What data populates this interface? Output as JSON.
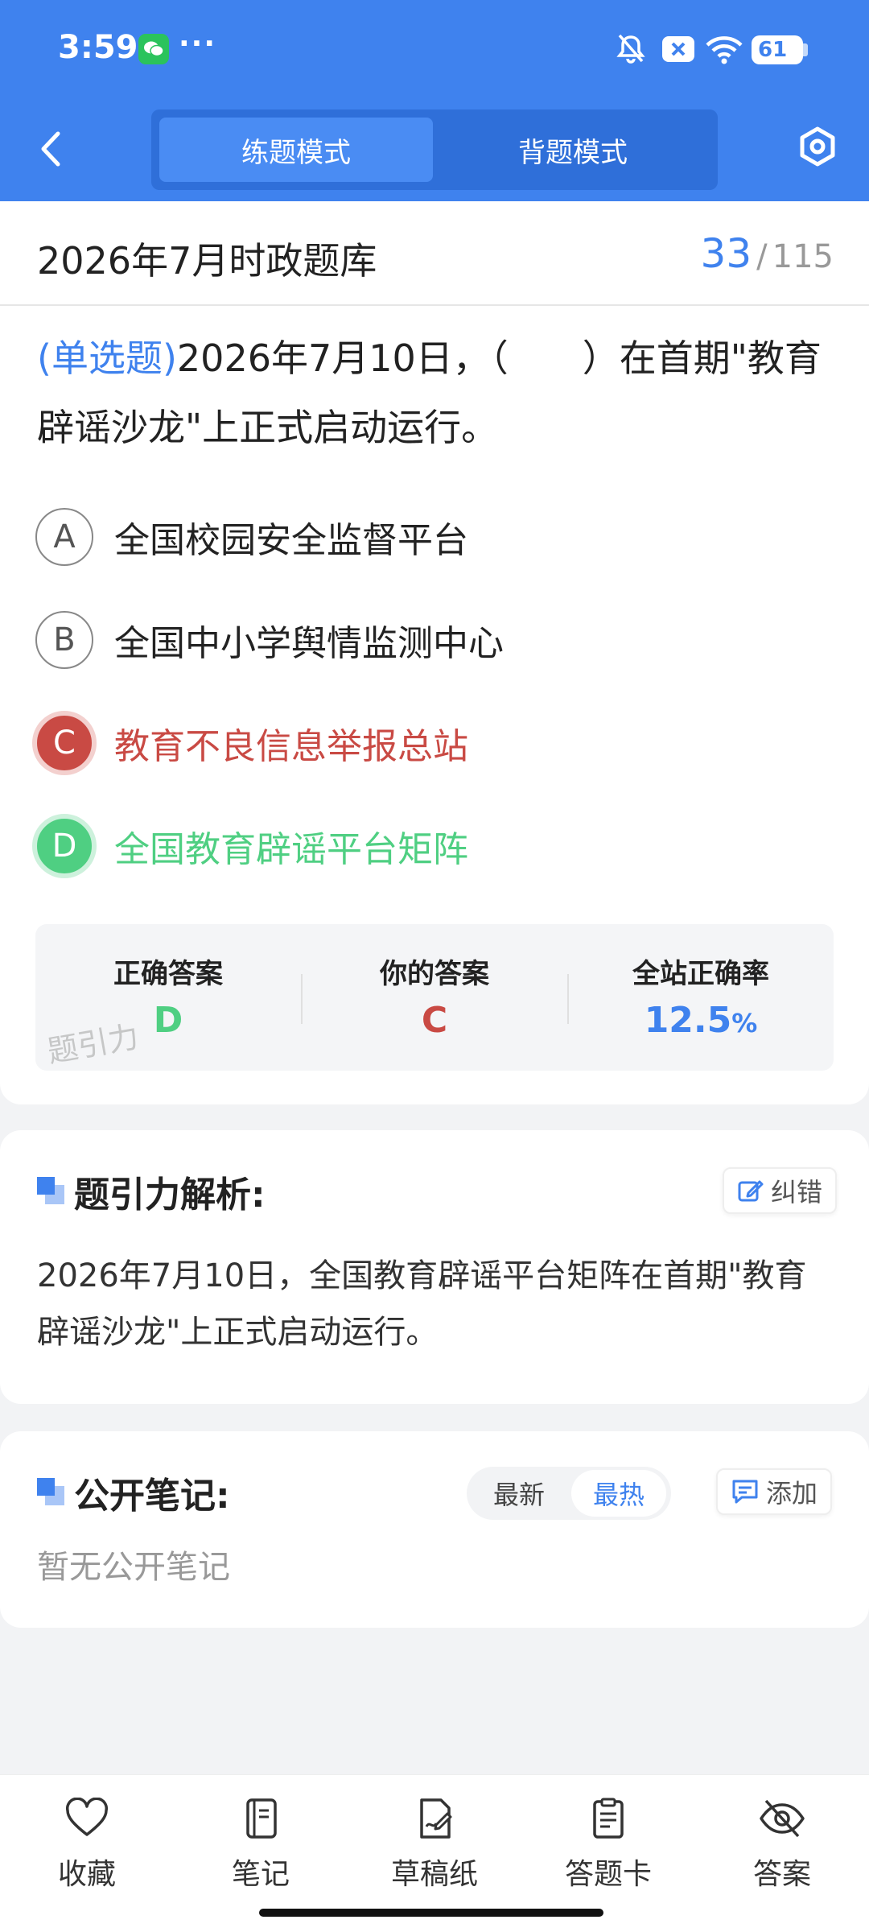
{
  "status_bar": {
    "time": "3:59",
    "more": "···",
    "battery": "61"
  },
  "header": {
    "mode_practice": "练题模式",
    "mode_recite": "背题模式"
  },
  "question_bank": {
    "title": "2026年7月时政题库",
    "current": "33",
    "separator": "/",
    "total": "115"
  },
  "question": {
    "type": "(单选题)",
    "text": "2026年7月10日，（　　）在首期\"教育辟谣沙龙\"上正式启动运行。",
    "options": [
      {
        "letter": "A",
        "text": "全国校园安全监督平台",
        "state": "normal"
      },
      {
        "letter": "B",
        "text": "全国中小学舆情监测中心",
        "state": "normal"
      },
      {
        "letter": "C",
        "text": "教育不良信息举报总站",
        "state": "wrong"
      },
      {
        "letter": "D",
        "text": "全国教育辟谣平台矩阵",
        "state": "correct"
      }
    ]
  },
  "answer_summary": {
    "correct_label": "正确答案",
    "correct_value": "D",
    "yours_label": "你的答案",
    "yours_value": "C",
    "rate_label": "全站正确率",
    "rate_value": "12.5",
    "rate_unit": "%",
    "watermark": "题引力"
  },
  "analysis": {
    "title": "题引力解析:",
    "correct_btn": "纠错",
    "text": "2026年7月10日，全国教育辟谣平台矩阵在首期\"教育辟谣沙龙\"上正式启动运行。"
  },
  "notes": {
    "title": "公开笔记:",
    "sort_latest": "最新",
    "sort_hot": "最热",
    "add_btn": "添加",
    "empty": "暂无公开笔记"
  },
  "bottom_tabs": [
    {
      "label": "收藏",
      "icon": "heart-icon"
    },
    {
      "label": "笔记",
      "icon": "notebook-icon"
    },
    {
      "label": "草稿纸",
      "icon": "draft-icon"
    },
    {
      "label": "答题卡",
      "icon": "answer-sheet-icon"
    },
    {
      "label": "答案",
      "icon": "eye-off-icon"
    }
  ],
  "colors": {
    "primary": "#3f82ee",
    "wrong": "#c94a44",
    "correct": "#4fcf82"
  }
}
